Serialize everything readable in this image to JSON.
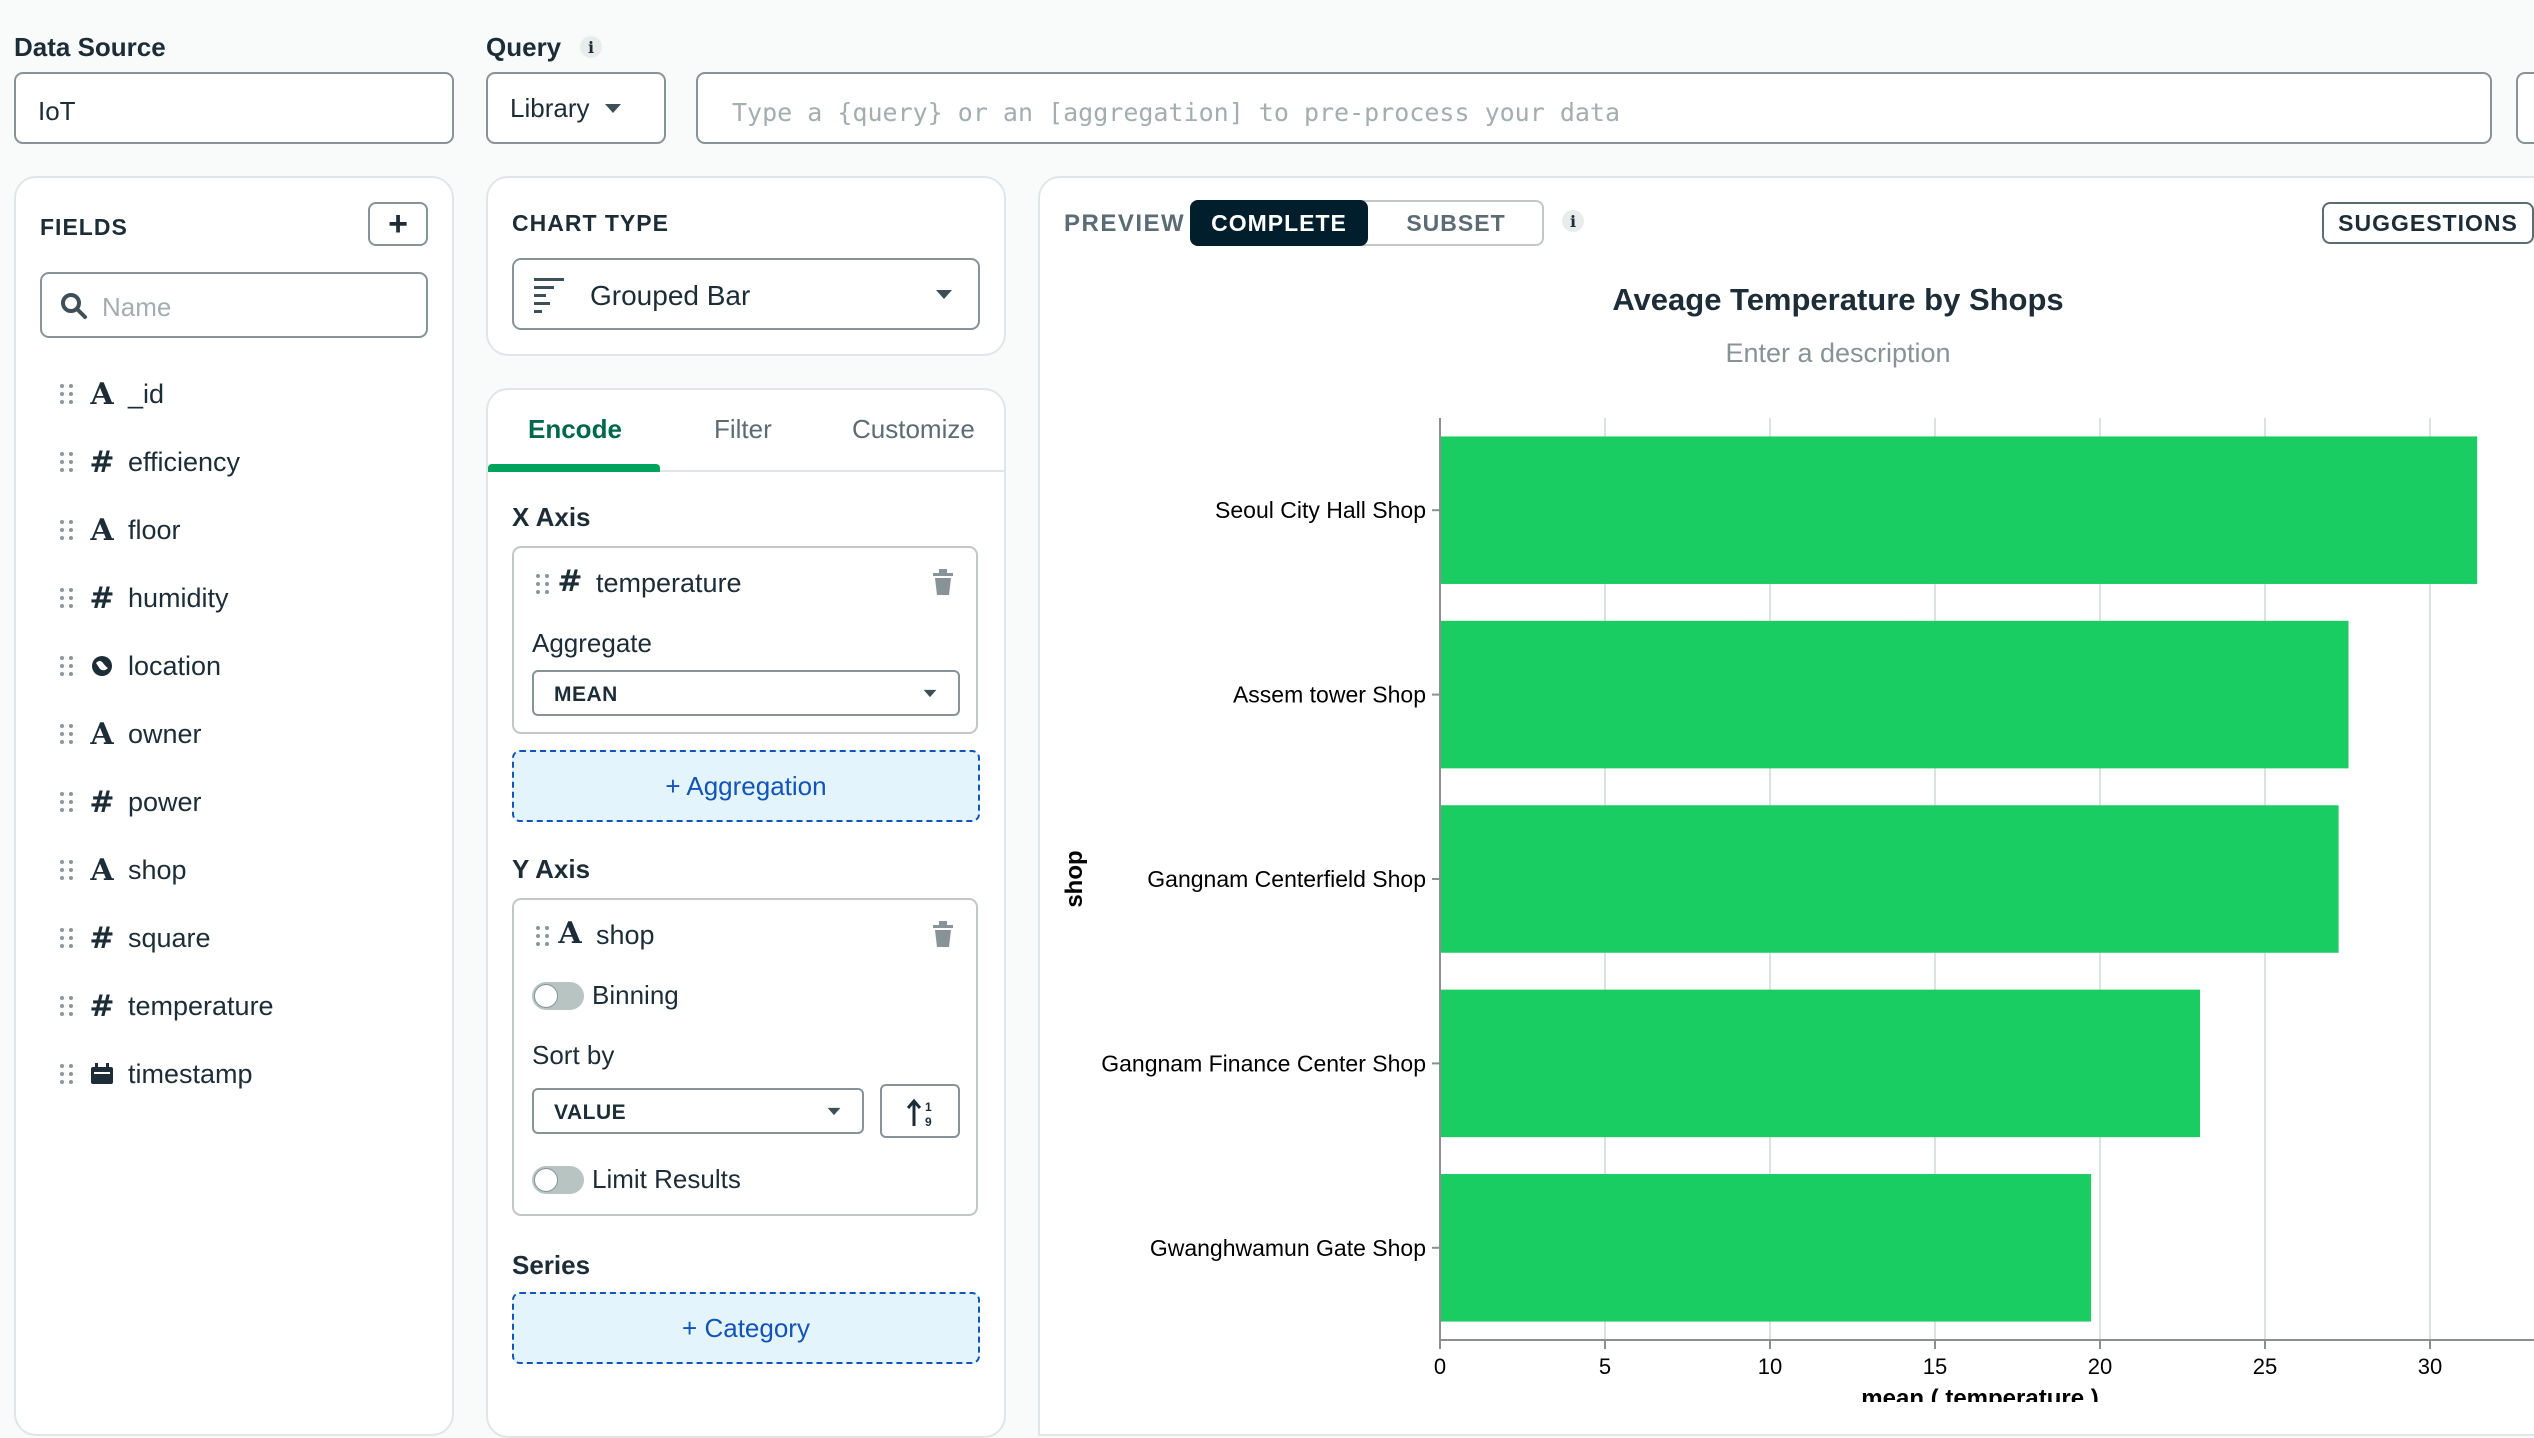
{
  "data_source": {
    "label": "Data Source",
    "value": "IoT"
  },
  "query": {
    "label": "Query",
    "library_label": "Library",
    "placeholder": "Type a {query} or an [aggregation] to pre-process your data"
  },
  "fields": {
    "title": "FIELDS",
    "search_placeholder": "Name",
    "items": [
      {
        "type": "A",
        "name": "_id"
      },
      {
        "type": "#",
        "name": "efficiency"
      },
      {
        "type": "A",
        "name": "floor"
      },
      {
        "type": "#",
        "name": "humidity"
      },
      {
        "type": "geo",
        "name": "location"
      },
      {
        "type": "A",
        "name": "owner"
      },
      {
        "type": "#",
        "name": "power"
      },
      {
        "type": "A",
        "name": "shop"
      },
      {
        "type": "#",
        "name": "square"
      },
      {
        "type": "#",
        "name": "temperature"
      },
      {
        "type": "date",
        "name": "timestamp"
      }
    ]
  },
  "chart_type": {
    "label": "CHART TYPE",
    "value": "Grouped Bar"
  },
  "tabs": {
    "encode": "Encode",
    "filter": "Filter",
    "customize": "Customize"
  },
  "encode": {
    "x_axis": {
      "label": "X Axis",
      "field_type": "#",
      "field": "temperature",
      "aggregate_label": "Aggregate",
      "aggregate_value": "MEAN",
      "add_aggregation": "+ Aggregation"
    },
    "y_axis": {
      "label": "Y Axis",
      "field_type": "A",
      "field": "shop",
      "binning_label": "Binning",
      "sort_by_label": "Sort by",
      "sort_by_value": "VALUE",
      "limit_label": "Limit Results"
    },
    "series": {
      "label": "Series",
      "add_category": "+ Category"
    }
  },
  "preview": {
    "label": "PREVIEW",
    "complete": "COMPLETE",
    "subset": "SUBSET",
    "suggestions": "SUGGESTIONS",
    "title": "Aveage Temperature by Shops",
    "description_placeholder": "Enter a description"
  },
  "colors": {
    "bar": "#19cd63",
    "accent": "#00684a",
    "dark": "#001e2b"
  },
  "chart_data": {
    "type": "bar",
    "orientation": "horizontal",
    "categories": [
      "Seoul City Hall Shop",
      "Assem tower Shop",
      "Gangnam Centerfield Shop",
      "Gangnam Finance Center Shop",
      "Gwanghwamun Gate Shop"
    ],
    "values": [
      31.4,
      27.5,
      27.2,
      23.0,
      19.7
    ],
    "title": "Aveage Temperature by Shops",
    "xlabel": "mean ( temperature )",
    "ylabel": "shop",
    "xticks": [
      "0",
      "5",
      "10",
      "15",
      "20",
      "25",
      "30"
    ],
    "xlim": [
      0,
      33
    ],
    "grid": true
  }
}
